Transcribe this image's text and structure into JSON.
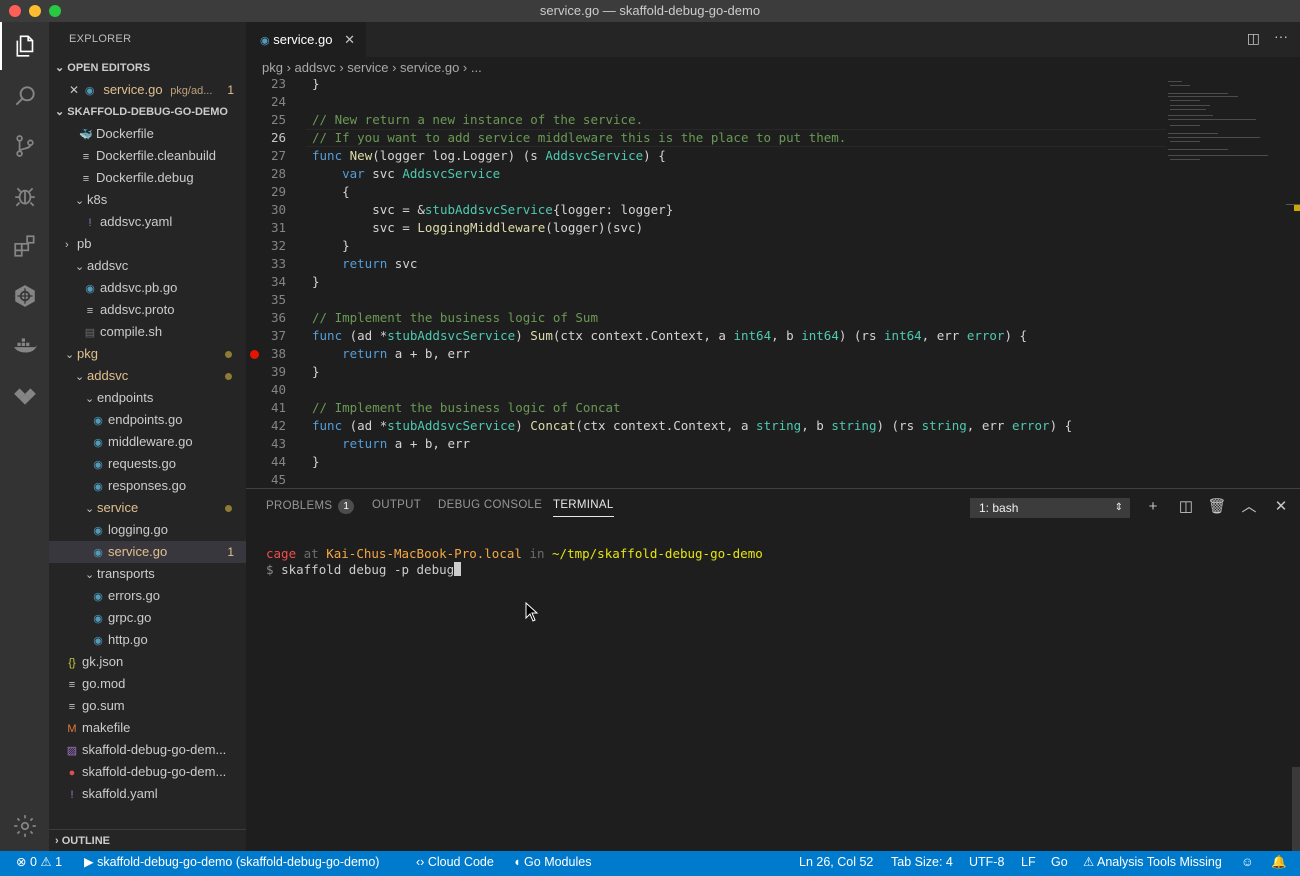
{
  "window": {
    "title": "service.go — skaffold-debug-go-demo"
  },
  "sidebar": {
    "title": "EXPLORER",
    "open_editors_label": "OPEN EDITORS",
    "open_editor": {
      "name": "service.go",
      "path": "pkg/ad...",
      "problems": "1"
    },
    "project_label": "SKAFFOLD-DEBUG-GO-DEMO",
    "tree": [
      {
        "label": "Dockerfile"
      },
      {
        "label": "Dockerfile.cleanbuild"
      },
      {
        "label": "Dockerfile.debug"
      },
      {
        "label": "k8s"
      },
      {
        "label": "addsvc.yaml"
      },
      {
        "label": "pb"
      },
      {
        "label": "addsvc"
      },
      {
        "label": "addsvc.pb.go"
      },
      {
        "label": "addsvc.proto"
      },
      {
        "label": "compile.sh"
      },
      {
        "label": "pkg"
      },
      {
        "label": "addsvc"
      },
      {
        "label": "endpoints"
      },
      {
        "label": "endpoints.go"
      },
      {
        "label": "middleware.go"
      },
      {
        "label": "requests.go"
      },
      {
        "label": "responses.go"
      },
      {
        "label": "service"
      },
      {
        "label": "logging.go"
      },
      {
        "label": "service.go",
        "badge": "1"
      },
      {
        "label": "transports"
      },
      {
        "label": "errors.go"
      },
      {
        "label": "grpc.go"
      },
      {
        "label": "http.go"
      },
      {
        "label": "gk.json"
      },
      {
        "label": "go.mod"
      },
      {
        "label": "go.sum"
      },
      {
        "label": "makefile"
      },
      {
        "label": "skaffold-debug-go-dem..."
      },
      {
        "label": "skaffold-debug-go-dem..."
      },
      {
        "label": "skaffold.yaml"
      }
    ],
    "outline_label": "OUTLINE"
  },
  "editor": {
    "tab_label": "service.go",
    "breadcrumb": [
      "pkg",
      "addsvc",
      "service",
      "service.go",
      "..."
    ],
    "line_numbers": [
      "23",
      "24",
      "25",
      "26",
      "27",
      "28",
      "29",
      "30",
      "31",
      "32",
      "33",
      "34",
      "35",
      "36",
      "37",
      "38",
      "39",
      "40",
      "41",
      "42",
      "43",
      "44",
      "45"
    ],
    "lines": [
      "}",
      "",
      "// New return a new instance of the service.",
      "// If you want to add service middleware this is the place to put them.",
      "func New(logger log.Logger) (s AddsvcService) {",
      "    var svc AddsvcService",
      "    {",
      "        svc = &stubAddsvcService{logger: logger}",
      "        svc = LoggingMiddleware(logger)(svc)",
      "    }",
      "    return svc",
      "}",
      "",
      "// Implement the business logic of Sum",
      "func (ad *stubAddsvcService) Sum(ctx context.Context, a int64, b int64) (rs int64, err error) {",
      "    return a + b, err",
      "}",
      "",
      "// Implement the business logic of Concat",
      "func (ad *stubAddsvcService) Concat(ctx context.Context, a string, b string) (rs string, err error) {",
      "    return a + b, err",
      "}",
      ""
    ]
  },
  "panel": {
    "tabs": {
      "problems": "PROBLEMS",
      "problems_count": "1",
      "output": "OUTPUT",
      "debug_console": "DEBUG CONSOLE",
      "terminal": "TERMINAL"
    },
    "terminal_select": "1: bash",
    "prompt": {
      "user": "cage",
      "at": "at",
      "host": "Kai-Chus-MacBook-Pro.local",
      "in": "in",
      "path": "~/tmp/skaffold-debug-go-demo"
    },
    "command_prefix": "$",
    "command": "skaffold debug -p debug"
  },
  "statusbar": {
    "errors": "0",
    "warnings": "1",
    "context": "skaffold-debug-go-demo (skaffold-debug-go-demo)",
    "cloud_code": "Cloud Code",
    "go_modules": "Go Modules",
    "position": "Ln 26, Col 52",
    "tab_size": "Tab Size: 4",
    "encoding": "UTF-8",
    "eol": "LF",
    "language": "Go",
    "analysis": "Analysis Tools Missing"
  },
  "colors": {
    "accent": "#007acc",
    "modified": "#e2c08d",
    "breakpoint": "#e51400"
  }
}
